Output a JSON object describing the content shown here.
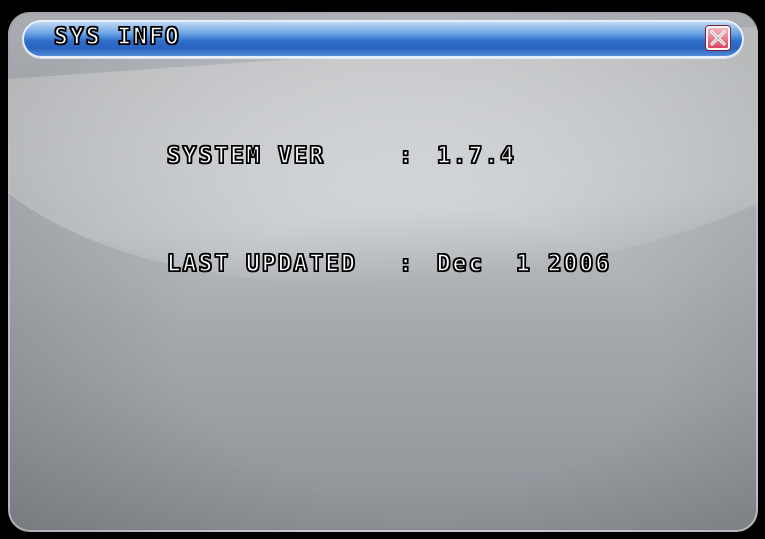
{
  "window": {
    "title": "SYS INFO",
    "close_icon": "close-icon"
  },
  "info": [
    {
      "label": "SYSTEM VER",
      "sep": ":",
      "value": "1.7.4"
    },
    {
      "label": "LAST UPDATED",
      "sep": ":",
      "value": "Dec  1 2006"
    }
  ],
  "colors": {
    "titlebar": "#2f6fcb",
    "close": "#d7385a",
    "background": "#b8bcc1"
  }
}
